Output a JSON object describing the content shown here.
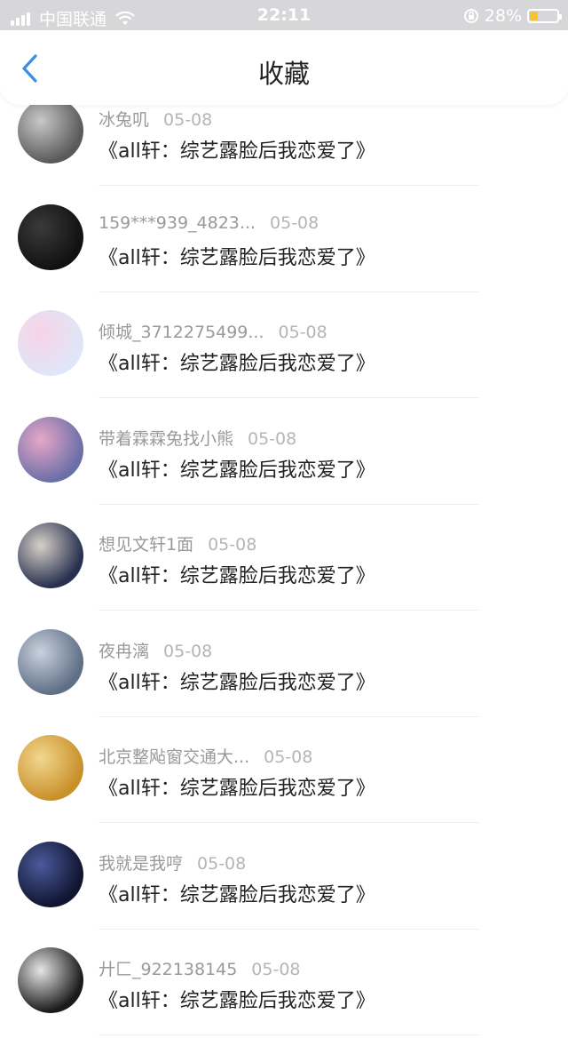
{
  "status_bar": {
    "carrier": "中国联通",
    "time": "22:11",
    "battery_percent": "28%",
    "battery_level": 0.28
  },
  "header": {
    "title": "收藏",
    "back_icon": "chevron-left-icon"
  },
  "colors": {
    "accent": "#3a8ee6",
    "status_bar_bg": "#d7d7d9",
    "battery_fill": "#f4c431"
  },
  "items": [
    {
      "user": "冰兔叽",
      "date": "05-08",
      "title": "《all轩：综艺露脸后我恋爱了》",
      "avatar_colors": [
        "#5a5a5a",
        "#c8c8c8"
      ]
    },
    {
      "user": "159***939_4823...",
      "date": "05-08",
      "title": "《all轩：综艺露脸后我恋爱了》",
      "avatar_colors": [
        "#111111",
        "#3a3a3a"
      ]
    },
    {
      "user": "倾城_3712275499...",
      "date": "05-08",
      "title": "《all轩：综艺露脸后我恋爱了》",
      "avatar_colors": [
        "#dfe6f8",
        "#f7d3e6"
      ]
    },
    {
      "user": "带着霖霖兔找小熊",
      "date": "05-08",
      "title": "《all轩：综艺露脸后我恋爱了》",
      "avatar_colors": [
        "#6b6fa8",
        "#e7a7c8"
      ]
    },
    {
      "user": "想见文轩1面",
      "date": "05-08",
      "title": "《all轩：综艺露脸后我恋爱了》",
      "avatar_colors": [
        "#27304f",
        "#d6d0c8"
      ]
    },
    {
      "user": "夜冉漓",
      "date": "05-08",
      "title": "《all轩：综艺露脸后我恋爱了》",
      "avatar_colors": [
        "#5f6f86",
        "#c9d1dd"
      ]
    },
    {
      "user": "北京整飐窗交通大...",
      "date": "05-08",
      "title": "《all轩：综艺露脸后我恋爱了》",
      "avatar_colors": [
        "#c9902a",
        "#f2d78e"
      ]
    },
    {
      "user": "我就是我哼",
      "date": "05-08",
      "title": "《all轩：综艺露脸后我恋爱了》",
      "avatar_colors": [
        "#0f1430",
        "#4a5b9c"
      ]
    },
    {
      "user": "廾匚_922138145",
      "date": "05-08",
      "title": "《all轩：综艺露脸后我恋爱了》",
      "avatar_colors": [
        "#1a1a1a",
        "#e6e6e6"
      ]
    }
  ]
}
